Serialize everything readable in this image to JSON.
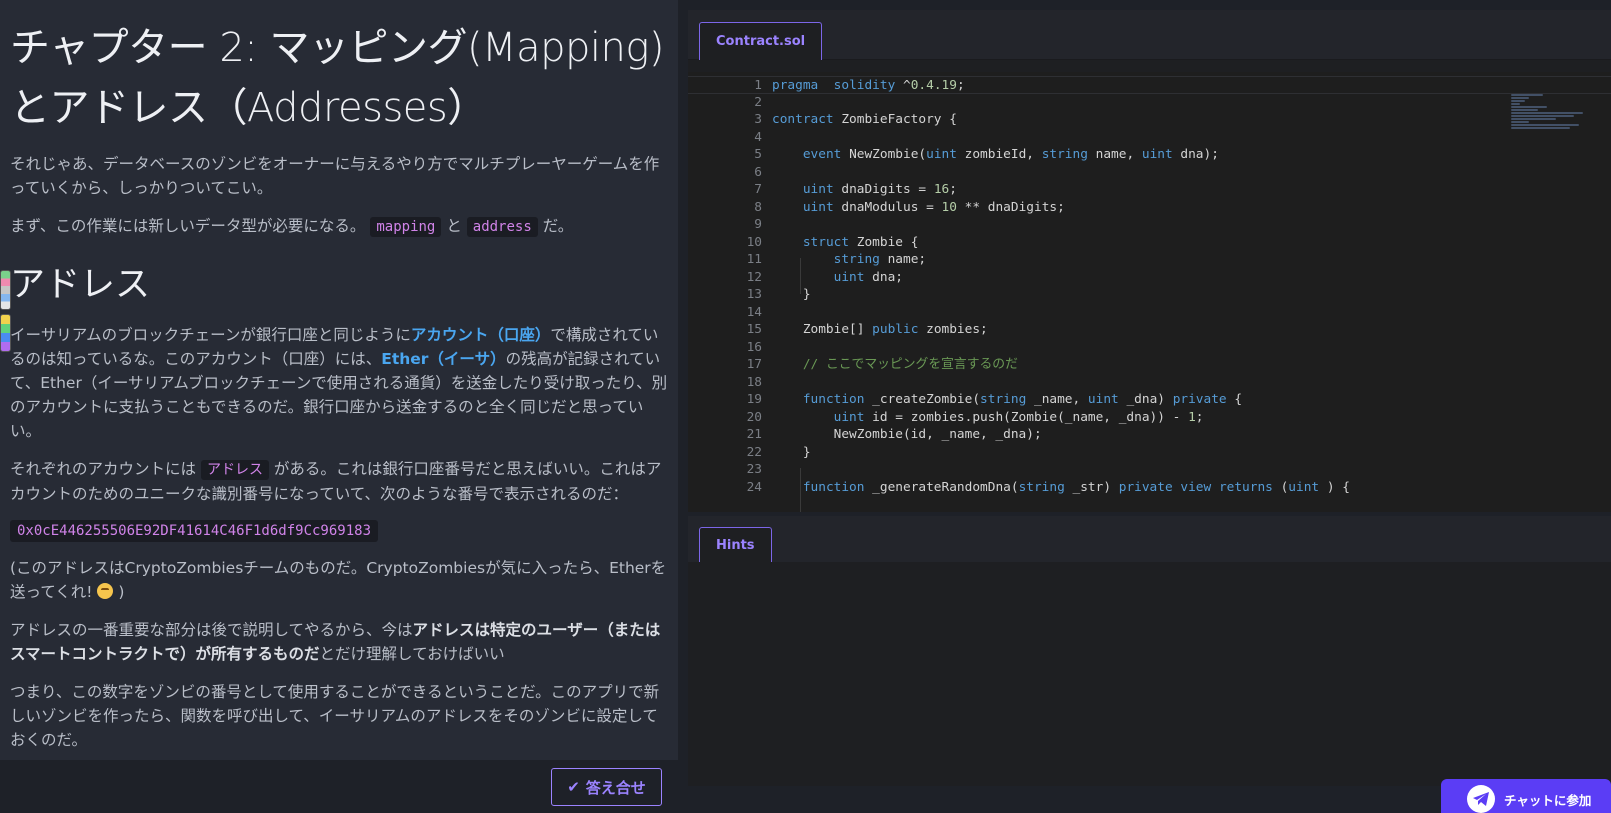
{
  "lesson": {
    "title_line1": "チャプター 2: マッピング(Mapping)",
    "title_line2": "とアドレス（Addresses）",
    "intro_p1": "それじゃあ、データベースのゾンビをオーナーに与えるやり方でマルチプレーヤーゲームを作っていくから、しっかりついてこい。",
    "intro_p2_a": "まず、この作業には新しいデータ型が必要になる。",
    "intro_p2_code1": "mapping",
    "intro_p2_b": "と",
    "intro_p2_code2": "address",
    "intro_p2_c": "だ。",
    "section_heading": "アドレス",
    "p3_a": "イーサリアムのブロックチェーンが銀行口座と同じように",
    "p3_link1": "アカウント（口座）",
    "p3_b": "で構成されているのは知っているな。このアカウント（口座）には、",
    "p3_link2": "Ether（イーサ）",
    "p3_c": "の残高が記録されていて、Ether（イーサリアムブロックチェーンで使用される通貨）を送金したり受け取ったり、別のアカウントに支払うこともできるのだ。銀行口座から送金するのと全く同じだと思っていい。",
    "p4_a": "それぞれのアカウントには",
    "p4_code": "アドレス",
    "p4_b": "がある。これは銀行口座番号だと思えばいい。これはアカウントのためのユニークな識別番号になっていて、次のような番号で表示されるのだ：",
    "address_example": "0x0cE446255506E92DF41614C46F1d6df9Cc969183",
    "p5_a": "(このアドレスはCryptoZombiesチームのものだ。CryptoZombiesが気に入ったら、Etherを送ってくれ! ",
    "p5_b": " )",
    "p6_a": "アドレスの一番重要な部分は後で説明してやるから、今は",
    "p6_bold": "アドレスは特定のユーザー（またはスマートコントラクトで）が所有するものだ",
    "p6_b": "とだけ理解しておけばいい",
    "p7": "つまり、この数字をゾンビの番号として使用することができるということだ。このアプリで新しいゾンビを作ったら、関数を呼び出して、イーサリアムのアドレスをそのゾンビに設定しておくのだ。",
    "check_button": "答え合せ"
  },
  "editor": {
    "tab_label": "Contract.sol",
    "lines": [
      {
        "n": "1",
        "tokens": [
          [
            "kw",
            "pragma"
          ],
          [
            "",
            "  "
          ],
          [
            "kw",
            "solidity"
          ],
          [
            "",
            " ^"
          ],
          [
            "num",
            "0.4.19"
          ],
          [
            "",
            ";"
          ]
        ]
      },
      {
        "n": "2",
        "tokens": []
      },
      {
        "n": "3",
        "tokens": [
          [
            "kw",
            "contract"
          ],
          [
            "",
            " ZombieFactory {"
          ]
        ]
      },
      {
        "n": "4",
        "tokens": []
      },
      {
        "n": "5",
        "tokens": [
          [
            "",
            "    "
          ],
          [
            "kw",
            "event"
          ],
          [
            "",
            " NewZombie("
          ],
          [
            "kw",
            "uint"
          ],
          [
            "",
            " zombieId, "
          ],
          [
            "kw",
            "string"
          ],
          [
            "",
            " name, "
          ],
          [
            "kw",
            "uint"
          ],
          [
            "",
            " dna);"
          ]
        ]
      },
      {
        "n": "6",
        "tokens": []
      },
      {
        "n": "7",
        "tokens": [
          [
            "",
            "    "
          ],
          [
            "kw",
            "uint"
          ],
          [
            "",
            " dnaDigits = "
          ],
          [
            "num",
            "16"
          ],
          [
            "",
            ";"
          ]
        ]
      },
      {
        "n": "8",
        "tokens": [
          [
            "",
            "    "
          ],
          [
            "kw",
            "uint"
          ],
          [
            "",
            " dnaModulus = "
          ],
          [
            "num",
            "10"
          ],
          [
            "",
            " ** dnaDigits;"
          ]
        ]
      },
      {
        "n": "9",
        "tokens": []
      },
      {
        "n": "10",
        "tokens": [
          [
            "",
            "    "
          ],
          [
            "kw",
            "struct"
          ],
          [
            "",
            " Zombie {"
          ]
        ]
      },
      {
        "n": "11",
        "tokens": [
          [
            "",
            "        "
          ],
          [
            "kw",
            "string"
          ],
          [
            "",
            " name;"
          ]
        ]
      },
      {
        "n": "12",
        "tokens": [
          [
            "",
            "        "
          ],
          [
            "kw",
            "uint"
          ],
          [
            "",
            " dna;"
          ]
        ]
      },
      {
        "n": "13",
        "tokens": [
          [
            "",
            "    }"
          ]
        ]
      },
      {
        "n": "14",
        "tokens": []
      },
      {
        "n": "15",
        "tokens": [
          [
            "",
            "    Zombie[] "
          ],
          [
            "kw",
            "public"
          ],
          [
            "",
            " zombies;"
          ]
        ]
      },
      {
        "n": "16",
        "tokens": []
      },
      {
        "n": "17",
        "tokens": [
          [
            "",
            "    "
          ],
          [
            "cm",
            "// ここでマッピングを宣言するのだ"
          ]
        ]
      },
      {
        "n": "18",
        "tokens": []
      },
      {
        "n": "19",
        "tokens": [
          [
            "",
            "    "
          ],
          [
            "kw",
            "function"
          ],
          [
            "",
            " _createZombie("
          ],
          [
            "kw",
            "string"
          ],
          [
            "",
            " _name, "
          ],
          [
            "kw",
            "uint"
          ],
          [
            "",
            " _dna) "
          ],
          [
            "kw",
            "private"
          ],
          [
            "",
            " {"
          ]
        ]
      },
      {
        "n": "20",
        "tokens": [
          [
            "",
            "        "
          ],
          [
            "kw",
            "uint"
          ],
          [
            "",
            " id = zombies.push(Zombie(_name, _dna)) - "
          ],
          [
            "num",
            "1"
          ],
          [
            "",
            ";"
          ]
        ]
      },
      {
        "n": "21",
        "tokens": [
          [
            "",
            "        NewZombie(id, _name, _dna);"
          ]
        ]
      },
      {
        "n": "22",
        "tokens": [
          [
            "",
            "    }"
          ]
        ]
      },
      {
        "n": "23",
        "tokens": []
      },
      {
        "n": "24",
        "tokens": [
          [
            "",
            "    "
          ],
          [
            "kw",
            "function"
          ],
          [
            "",
            " _generateRandomDna("
          ],
          [
            "kw",
            "string"
          ],
          [
            "",
            " _str) "
          ],
          [
            "kw",
            "private"
          ],
          [
            "",
            " "
          ],
          [
            "kw",
            "view"
          ],
          [
            "",
            " "
          ],
          [
            "kw",
            "returns"
          ],
          [
            "",
            " ("
          ],
          [
            "kw",
            "uint"
          ],
          [
            "",
            " ) {"
          ]
        ]
      }
    ]
  },
  "hints": {
    "tab_label": "Hints"
  },
  "chat": {
    "label": "チャットに参加"
  }
}
